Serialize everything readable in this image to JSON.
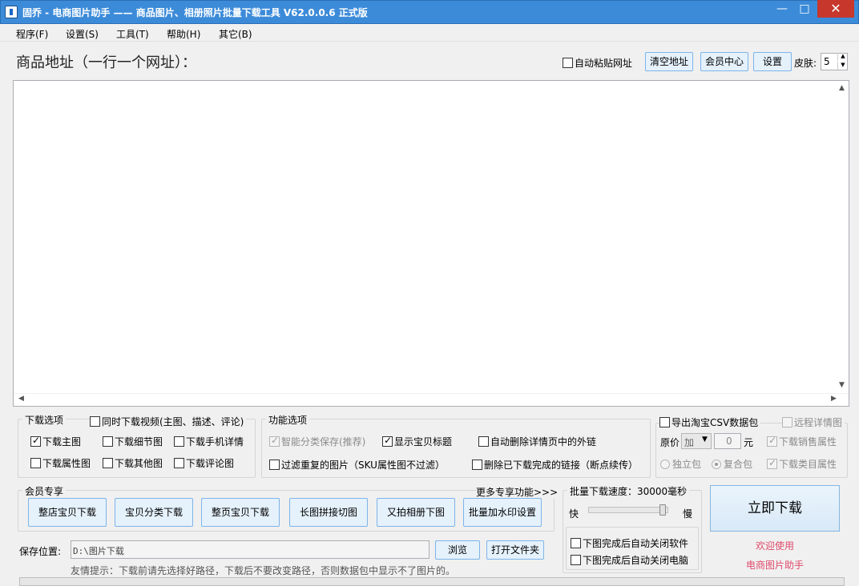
{
  "window": {
    "title": "固乔 - 电商图片助手 —— 商品图片、相册照片批量下载工具 V62.0.0.6 正式版",
    "minimize": "—",
    "maximize": "□",
    "close": "✕"
  },
  "menu": {
    "items": [
      "程序(F)",
      "设置(S)",
      "工具(T)",
      "帮助(H)",
      "其它(B)"
    ]
  },
  "header": {
    "url_label": "商品地址（一行一个网址）：",
    "auto_paste": "自动粘贴网址",
    "clear_btn": "清空地址",
    "member_btn": "会员中心",
    "settings_btn": "设置",
    "skin_label": "皮肤:",
    "skin_value": "5"
  },
  "download_options": {
    "legend": "下载选项",
    "video": "同时下载视频(主图、描述、评论)",
    "main_img": "下载主图",
    "detail_img": "下载细节图",
    "mobile_detail": "下载手机详情",
    "attr_img": "下载属性图",
    "other_img": "下载其他图",
    "review_img": "下载评论图"
  },
  "func_options": {
    "legend": "功能选项",
    "smart_save": "智能分类保存(推荐)",
    "show_title": "显示宝贝标题",
    "remove_links": "自动删除详情页中的外链",
    "filter_dup": "过滤重复的图片（SKU属性图不过滤）",
    "delete_done": "删除已下载完成的链接（断点续传）"
  },
  "csv": {
    "export": "导出淘宝CSV数据包",
    "remote_detail": "远程详情图",
    "price_label": "原价",
    "price_op": "加",
    "price_value": "0",
    "price_unit": "元",
    "sales_attr": "下载销售属性",
    "standalone": "独立包",
    "composite": "复合包",
    "category_attr": "下载类目属性"
  },
  "member": {
    "legend": "会员专享",
    "more": "更多专享功能>>>",
    "buttons": [
      "整店宝贝下载",
      "宝贝分类下载",
      "整页宝贝下载",
      "长图拼接切图",
      "又拍相册下图",
      "批量加水印设置"
    ]
  },
  "speed": {
    "legend": "批量下载速度：30000毫秒",
    "fast": "快",
    "slow": "慢",
    "level": 0.97,
    "close_app": "下图完成后自动关闭软件",
    "shutdown": "下图完成后自动关闭电脑"
  },
  "save": {
    "label": "保存位置:",
    "path": "D:\\图片下载",
    "browse": "浏览",
    "open_folder": "打开文件夹",
    "tip": "友情提示：下载前请先选择好路径，下载后不要改变路径，否则数据包中显示不了图片的。"
  },
  "action": {
    "download_now": "立即下载",
    "welcome_line1": "欢迎使用",
    "welcome_line2": "电商图片助手"
  }
}
